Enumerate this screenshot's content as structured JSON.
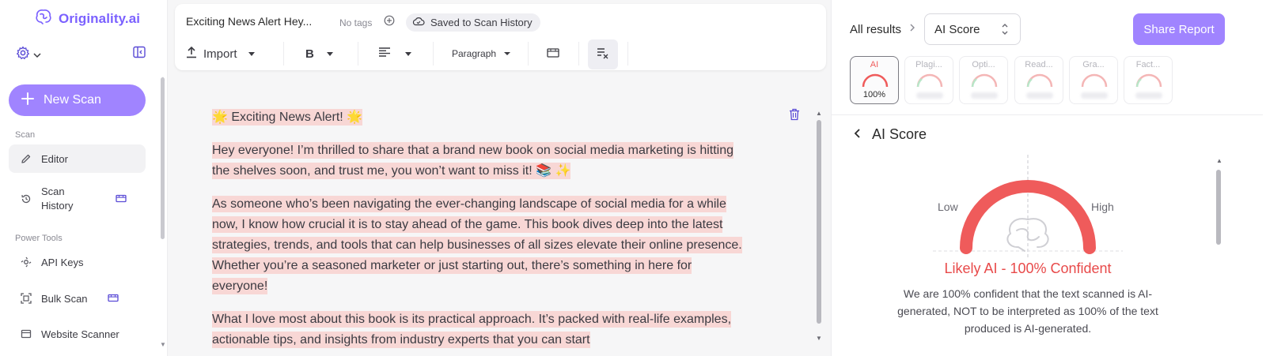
{
  "sidebar": {
    "logo_text": "Originality.ai",
    "new_scan_label": "New Scan",
    "scan_section": "Scan",
    "power_tools_section": "Power Tools",
    "items": [
      {
        "label": "Editor"
      },
      {
        "label": "Scan History"
      },
      {
        "label": "API Keys"
      },
      {
        "label": "Bulk Scan"
      },
      {
        "label": "Website Scanner"
      }
    ]
  },
  "editor": {
    "doc_title": "Exciting News Alert Hey...",
    "no_tags": "No tags",
    "saved_label": "Saved to Scan History",
    "toolbar": {
      "import_label": "Import",
      "bold_label": "B",
      "paragraph_label": "Paragraph"
    },
    "paragraphs": [
      "🌟 Exciting News Alert! 🌟",
      "Hey everyone! I’m thrilled to share that a brand new book on social media marketing is hitting the shelves soon, and trust me, you won’t want to miss it! 📚 ✨",
      "As someone who’s been navigating the ever-changing landscape of social media for a while now, I know how crucial it is to stay ahead of the game. This book dives deep into the latest strategies, trends, and tools that can help businesses of all sizes elevate their online presence. Whether you’re a seasoned marketer or just starting out, there’s something in here for everyone!",
      "What I love most about this book is its practical approach. It’s packed with real-life examples, actionable tips, and insights from industry experts that you can start"
    ]
  },
  "results": {
    "breadcrumb": "All results",
    "selected_view": "AI Score",
    "share_label": "Share Report",
    "tiles": [
      {
        "label": "AI",
        "value": "100%",
        "active": true
      },
      {
        "label": "Plagi...",
        "active": false
      },
      {
        "label": "Opti...",
        "active": false
      },
      {
        "label": "Read...",
        "active": false
      },
      {
        "label": "Gra...",
        "active": false
      },
      {
        "label": "Fact...",
        "active": false
      }
    ],
    "score_title": "AI Score",
    "gauge": {
      "low": "Low",
      "high": "High",
      "ai_percent": 100
    },
    "verdict": "Likely AI - 100% Confident",
    "explanation": "We are 100% confident that the text scanned is AI-generated, NOT to be interpreted as 100% of the text produced is AI-generated."
  },
  "colors": {
    "brand": "#a084ff",
    "highlight": "#f8d7d5",
    "ai_red": "#ef5b5b"
  }
}
